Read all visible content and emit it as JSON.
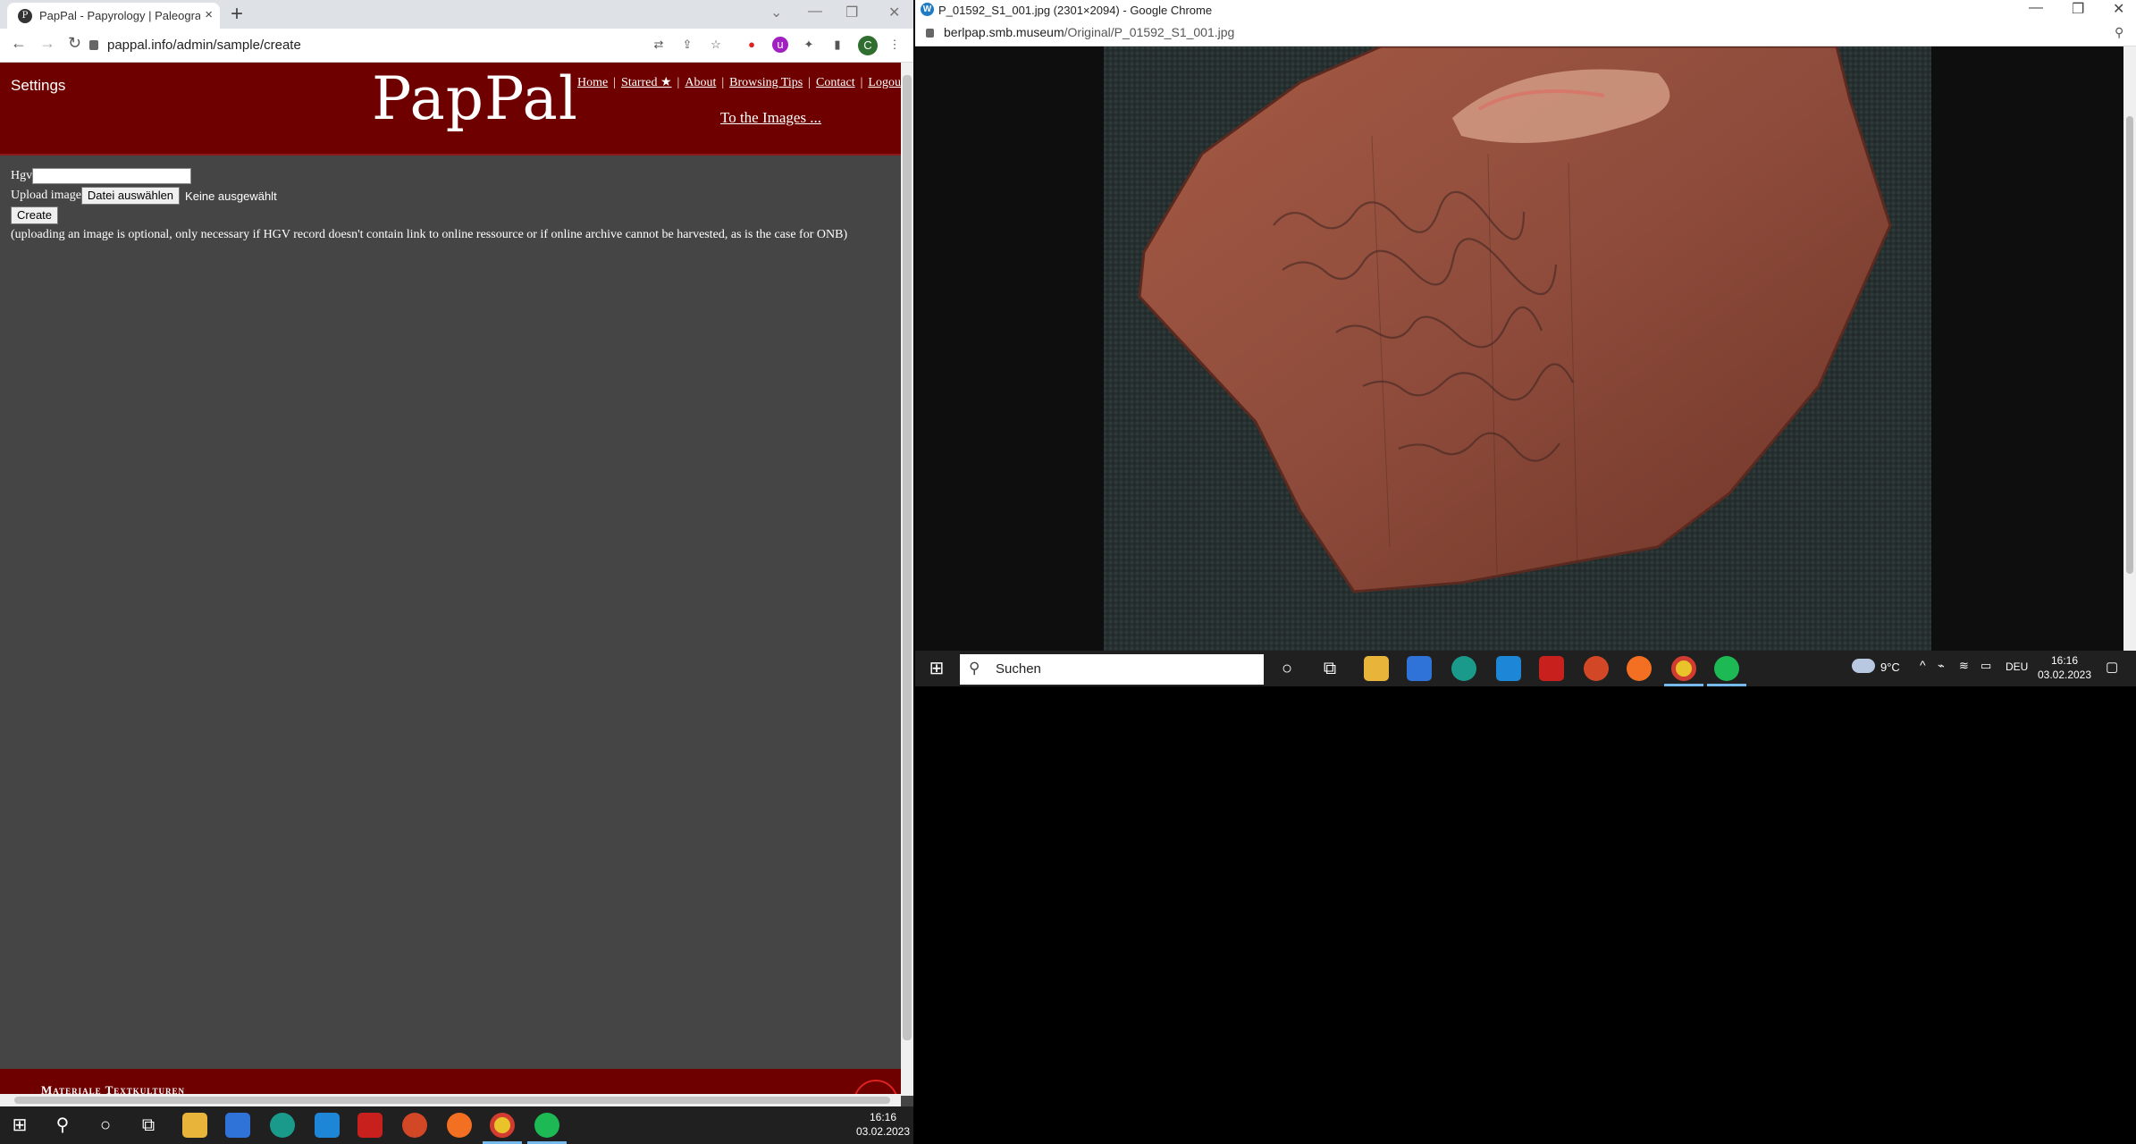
{
  "left_window": {
    "tab": {
      "title": "PapPal - Papyrology | Paleograph",
      "favicon": "P",
      "close": "×"
    },
    "new_tab": "+",
    "url": "pappal.info/admin/sample/create",
    "profile_initial": "C",
    "site": {
      "settings": "Settings",
      "logo": "PapPal",
      "nav": [
        "Home",
        "Starred ★",
        "About",
        "Browsing Tips",
        "Contact",
        "Logout"
      ],
      "nav_sep": "|",
      "to_images": "To the Images ...",
      "form": {
        "hgv_label": "Hgv",
        "upload_label": "Upload image",
        "file_button": "Datei auswählen",
        "file_status": "Keine ausgewählt",
        "create_button": "Create",
        "note": "(uploading an image is optional, only necessary if HGV record doesn't contain link to online ressource or if online archive cannot be harvested, as is the case for ONB)"
      },
      "footer_text": "Materiale Textkulturen"
    },
    "taskbar": {
      "time": "16:16",
      "date": "03.02.2023"
    }
  },
  "right_window": {
    "title": "P_01592_S1_001.jpg (2301×2094) - Google Chrome",
    "url_domain": "berlpap.smb.museum",
    "url_path": "/Original/P_01592_S1_001.jpg",
    "taskbar": {
      "search_placeholder": "Suchen",
      "weather": "9°C",
      "language": "DEU",
      "time": "16:16",
      "date": "03.02.2023"
    }
  },
  "colors": {
    "header": "#6e0000",
    "page_bg": "#454545",
    "taskbar": "#202020",
    "accent": "#76b9ed"
  },
  "icons": [
    "windows-start-icon",
    "search-icon",
    "cortana-icon",
    "task-view-icon",
    "file-explorer-icon",
    "store-icon",
    "edge-icon",
    "mail-icon",
    "acrobat-icon",
    "powerpoint-icon",
    "firefox-icon",
    "chrome-icon",
    "spotify-icon"
  ]
}
